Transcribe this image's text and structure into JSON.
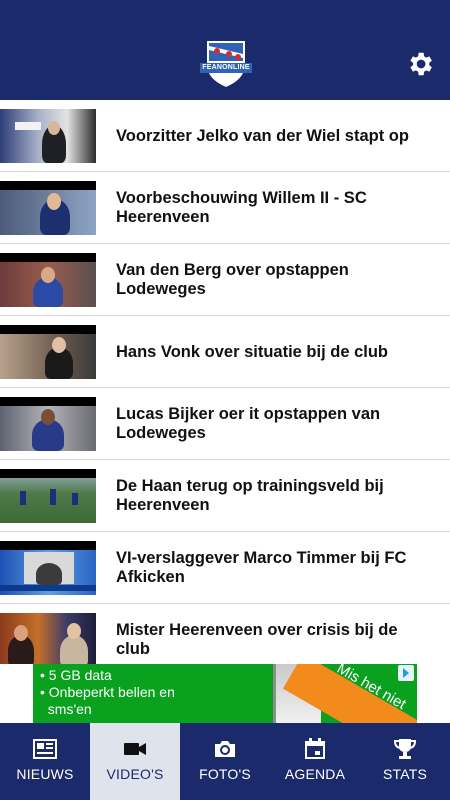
{
  "header": {
    "logo_text": "FEANONLINE",
    "settings_icon": "gear-icon"
  },
  "videos": [
    {
      "title": "Voorzitter Jelko van der Wiel stapt op"
    },
    {
      "title": "Voorbeschouwing Willem II - SC Heerenveen"
    },
    {
      "title": "Van den Berg over opstappen Lodeweges"
    },
    {
      "title": "Hans Vonk over situatie bij de club"
    },
    {
      "title": "Lucas Bijker oer it opstappen van Lodeweges"
    },
    {
      "title": "De Haan terug op trainingsveld bij Heerenveen"
    },
    {
      "title": "VI-verslaggever Marco Timmer bij FC Afkicken"
    },
    {
      "title": "Mister Heerenveen over crisis bij de club"
    }
  ],
  "ad": {
    "line1": "• 5 GB data",
    "line2": "• Onbeperkt bellen en",
    "line3": "  sms'en",
    "slogan": "Mis het niet",
    "colors": {
      "background": "#0aa11e",
      "corner": "#f28a1c"
    }
  },
  "tabs": [
    {
      "label": "NIEUWS",
      "icon": "newspaper-icon",
      "active": false
    },
    {
      "label": "VIDEO'S",
      "icon": "video-camera-icon",
      "active": true
    },
    {
      "label": "FOTO'S",
      "icon": "photo-camera-icon",
      "active": false
    },
    {
      "label": "AGENDA",
      "icon": "calendar-icon",
      "active": false
    },
    {
      "label": "STATS",
      "icon": "trophy-icon",
      "active": false
    }
  ],
  "colors": {
    "primary": "#1b2a6b",
    "active_tab": "#dfe3ec"
  }
}
